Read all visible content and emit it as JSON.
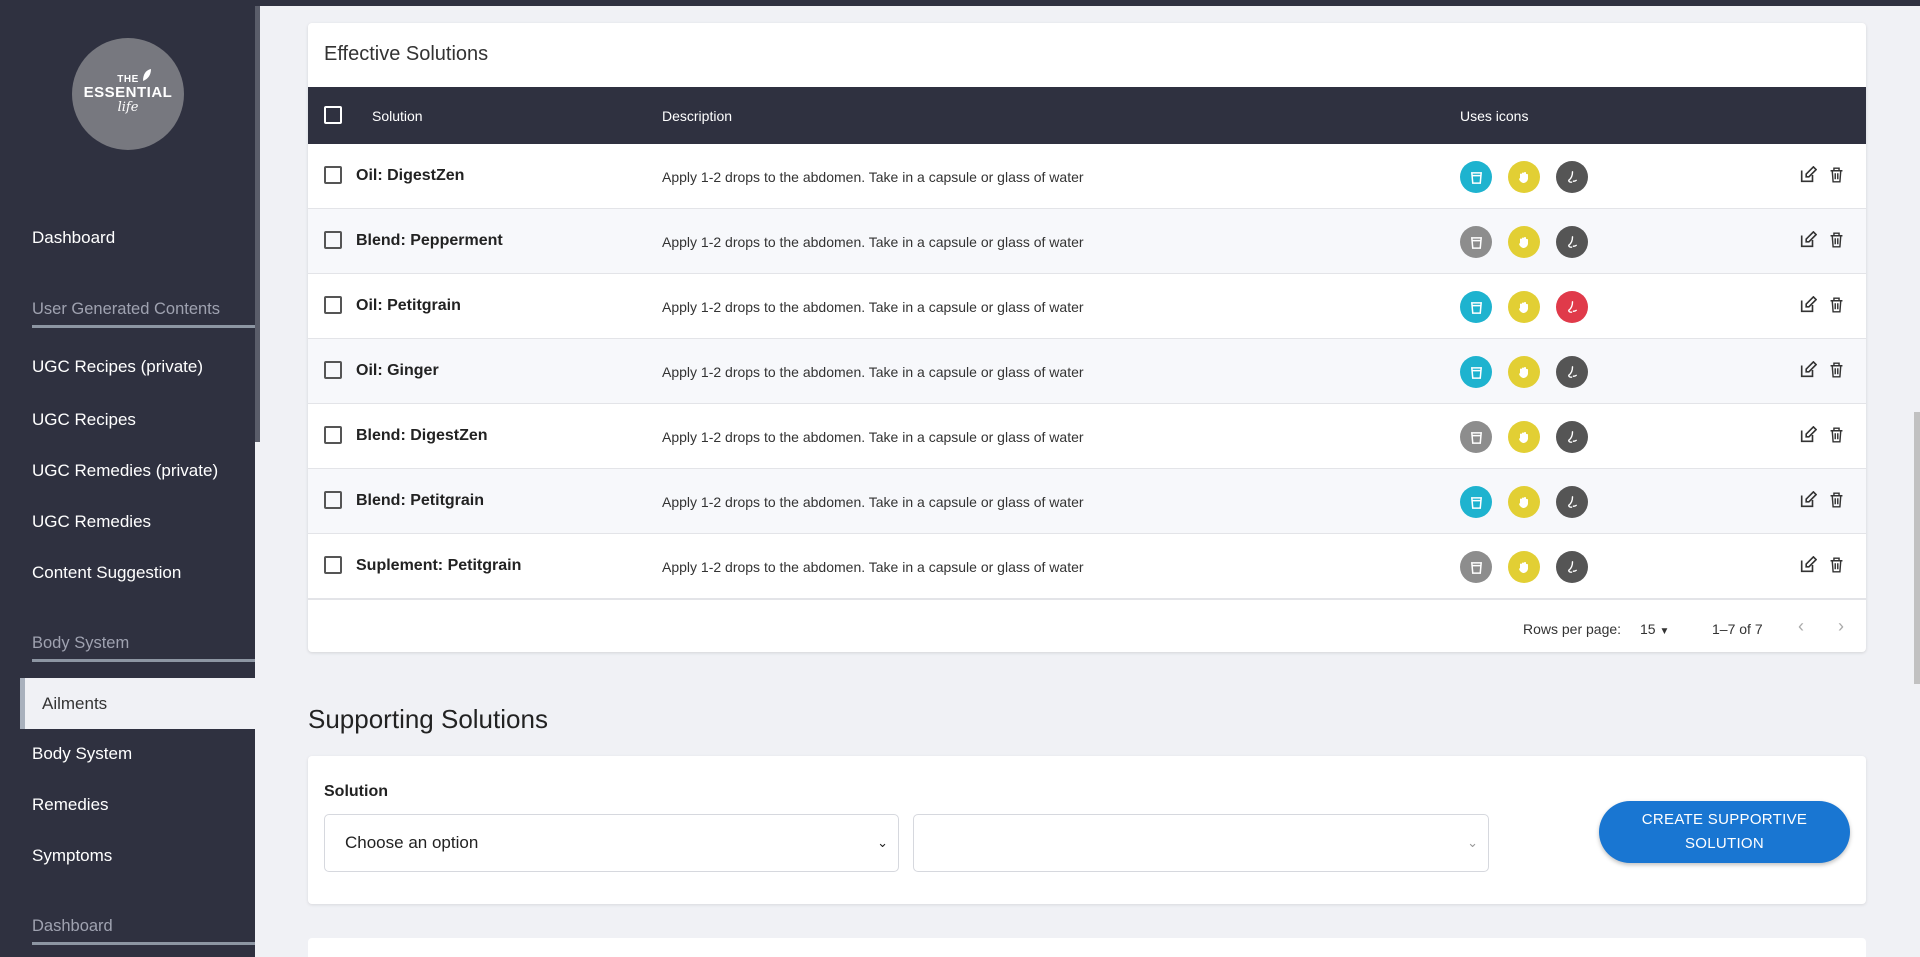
{
  "logo": {
    "line1": "THE",
    "line2": "ESSENTIAL",
    "line3": "life"
  },
  "sidebar": {
    "dashboard": "Dashboard",
    "section_ugc": "User Generated Contents",
    "ugc_recipes_private": "UGC Recipes (private)",
    "ugc_recipes": "UGC Recipes",
    "ugc_remedies_private": "UGC Remedies (private)",
    "ugc_remedies": "UGC Remedies",
    "content_suggestion": "Content Suggestion",
    "section_body": "Body System",
    "ailments": "Ailments",
    "body_system": "Body System",
    "remedies": "Remedies",
    "symptoms": "Symptoms",
    "section_dashboard": "Dashboard"
  },
  "effective": {
    "title": "Effective Solutions",
    "headers": {
      "solution": "Solution",
      "description": "Description",
      "uses_icons": "Uses icons"
    },
    "rows": [
      {
        "name": "Oil: DigestZen",
        "desc": "Apply 1-2 drops to the abdomen. Take in a capsule or glass of water",
        "internal": "active",
        "topical": "active",
        "aromatic": "dark"
      },
      {
        "name": "Blend: Pepperment",
        "desc": "Apply 1-2 drops to the abdomen. Take in a capsule or glass of water",
        "internal": "inactive",
        "topical": "active",
        "aromatic": "dark"
      },
      {
        "name": "Oil: Petitgrain",
        "desc": "Apply 1-2 drops to the abdomen. Take in a capsule or glass of water",
        "internal": "active",
        "topical": "active",
        "aromatic": "red"
      },
      {
        "name": "Oil: Ginger",
        "desc": "Apply 1-2 drops to the abdomen. Take in a capsule or glass of water",
        "internal": "active",
        "topical": "active",
        "aromatic": "dark"
      },
      {
        "name": "Blend: DigestZen",
        "desc": "Apply 1-2 drops to the abdomen. Take in a capsule or glass of water",
        "internal": "inactive",
        "topical": "active",
        "aromatic": "dark"
      },
      {
        "name": "Blend: Petitgrain",
        "desc": "Apply 1-2 drops to the abdomen. Take in a capsule or glass of water",
        "internal": "active",
        "topical": "active",
        "aromatic": "dark"
      },
      {
        "name": "Suplement: Petitgrain",
        "desc": "Apply 1-2 drops to the abdomen. Take in a capsule or glass of water",
        "internal": "inactive",
        "topical": "active",
        "aromatic": "dark"
      }
    ],
    "pager": {
      "rows_label": "Rows per page:",
      "rows_value": "15",
      "range": "1–7 of 7"
    }
  },
  "colors": {
    "internal_active": "#1eb3cf",
    "internal_inactive": "#8d8d8d",
    "topical": "#e2cf34",
    "aromatic_dark": "#555555",
    "aromatic_red": "#e03a4a"
  },
  "supporting": {
    "title": "Supporting Solutions",
    "label": "Solution",
    "select_placeholder": "Choose an option",
    "second_select_value": "",
    "create_line1": "CREATE SUPPORTIVE",
    "create_line2": "SOLUTION"
  }
}
